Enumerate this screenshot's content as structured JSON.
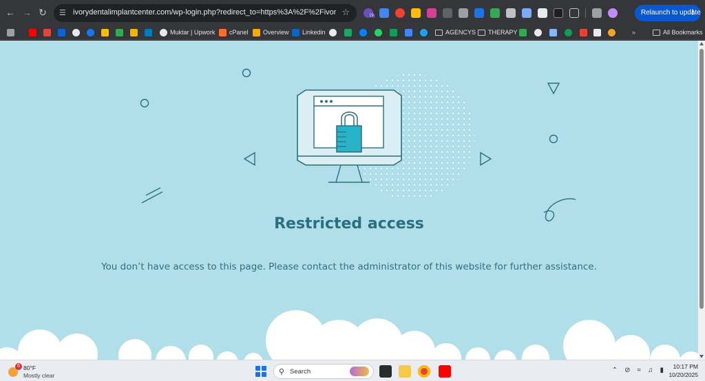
{
  "browser": {
    "url": "ivorydentalimplantcenter.com/wp-login.php?redirect_to=https%3A%2F%2Fivorydentalimpl...",
    "relaunch_label": "Relaunch to update",
    "ext_badge": "19",
    "bookmarks": {
      "upwork": "Muktar | Upwork",
      "cpanel": "cPanel",
      "overview": "Overview",
      "linkedin": "Linkedin",
      "agencys": "AGENCYS",
      "therapy": "THERAPY",
      "all": "All Bookmarks"
    }
  },
  "page": {
    "title": "Restricted access",
    "message": "You don’t have access to this page. Please contact the administrator of this website for further assistance."
  },
  "taskbar": {
    "weather_badge": "6",
    "temperature": "80°F",
    "condition": "Mostly clear",
    "search_label": "Search",
    "time": "10:17 PM",
    "date": "10/20/2025"
  },
  "colors": {
    "page_bg": "#b1dfe9",
    "accent": "#2a6f7e",
    "lock_fill": "#29b3c9",
    "relaunch_bg": "#0b57d0"
  }
}
